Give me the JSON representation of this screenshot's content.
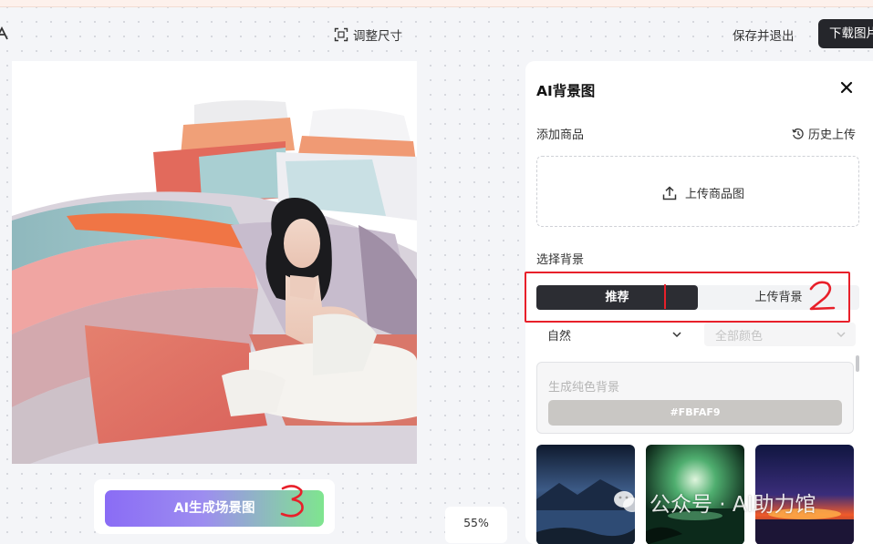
{
  "header": {
    "resize_label": "调整尺寸",
    "save_exit_label": "保存并退出",
    "download_label": "下载图片"
  },
  "canvas": {
    "generate_button_label": "AI生成场景图",
    "zoom_level": "55%"
  },
  "annotations": {
    "mark_2": "2",
    "mark_3": "3",
    "color": "#e8202a"
  },
  "panel": {
    "title": "AI背景图",
    "add_product_label": "添加商品",
    "history_upload_label": "历史上传",
    "upload_product_label": "上传商品图",
    "select_background_label": "选择背景",
    "tabs": [
      {
        "label": "推荐",
        "active": true
      },
      {
        "label": "上传背景",
        "active": false
      }
    ],
    "filters": {
      "style_value": "自然",
      "color_value": "全部颜色"
    },
    "solid_background": {
      "title": "生成纯色背景",
      "color_hex": "#FBFAF9"
    },
    "thumbnails": [
      {
        "name": "lake-mountain-night"
      },
      {
        "name": "green-aurora-lake"
      },
      {
        "name": "sunset-red-glow"
      }
    ]
  },
  "watermark": {
    "text": "公众号 · AI助力馆"
  },
  "colors": {
    "accent_dark": "#25262b",
    "gradient_start": "#8a6cf5",
    "gradient_end": "#7fe58f"
  }
}
